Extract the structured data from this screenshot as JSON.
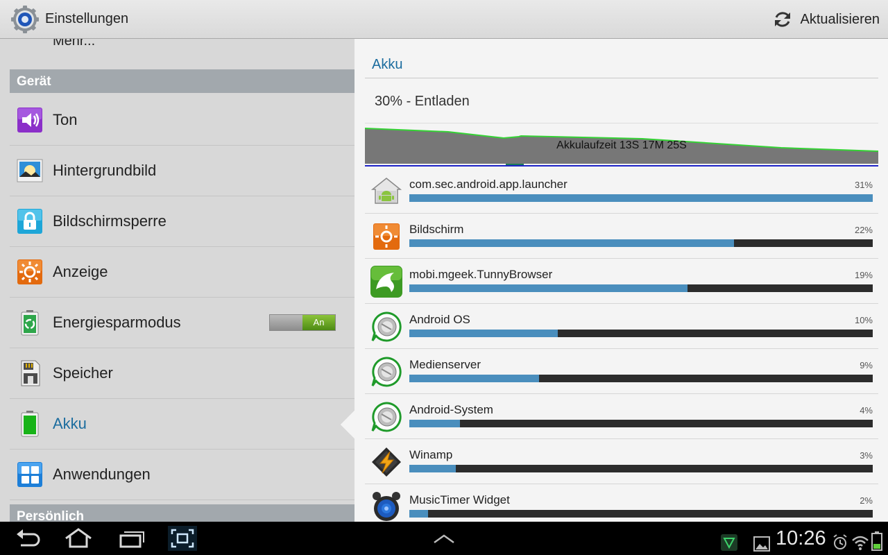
{
  "app": {
    "title": "Einstellungen",
    "refresh_label": "Aktualisieren"
  },
  "left": {
    "more_label": "Mehr...",
    "section_device": "Gerät",
    "section_personal": "Persönlich",
    "items": [
      {
        "label": "Ton",
        "icon": "sound-icon"
      },
      {
        "label": "Hintergrundbild",
        "icon": "wallpaper-icon"
      },
      {
        "label": "Bildschirmsperre",
        "icon": "lock-icon"
      },
      {
        "label": "Anzeige",
        "icon": "display-icon"
      },
      {
        "label": "Energiesparmodus",
        "icon": "power-saving-icon",
        "toggle": "An"
      },
      {
        "label": "Speicher",
        "icon": "storage-icon"
      },
      {
        "label": "Akku",
        "icon": "battery-icon",
        "selected": true
      },
      {
        "label": "Anwendungen",
        "icon": "applications-icon"
      }
    ]
  },
  "right": {
    "title": "Akku",
    "battery_status": "30% - Entladen",
    "graph_label": "Akkulaufzeit 13S 17M 25S",
    "usage": [
      {
        "name": "com.sec.android.app.launcher",
        "percent_label": "31%",
        "bar": 1.0,
        "icon": "launcher-icon"
      },
      {
        "name": "Bildschirm",
        "percent_label": "22%",
        "bar": 0.7,
        "icon": "brightness-icon"
      },
      {
        "name": "mobi.mgeek.TunnyBrowser",
        "percent_label": "19%",
        "bar": 0.6,
        "icon": "dolphin-browser-icon"
      },
      {
        "name": "Android OS",
        "percent_label": "10%",
        "bar": 0.32,
        "icon": "android-os-icon"
      },
      {
        "name": "Medienserver",
        "percent_label": "9%",
        "bar": 0.28,
        "icon": "media-server-icon"
      },
      {
        "name": "Android-System",
        "percent_label": "4%",
        "bar": 0.11,
        "icon": "android-system-icon"
      },
      {
        "name": "Winamp",
        "percent_label": "3%",
        "bar": 0.1,
        "icon": "winamp-icon"
      },
      {
        "name": "MusicTimer Widget",
        "percent_label": "2%",
        "bar": 0.04,
        "icon": "alarm-clock-icon"
      }
    ]
  },
  "status_bar": {
    "time": "10:26"
  },
  "colors": {
    "accent": "#1b6c9e",
    "usage_bar": "#4a8ebd",
    "toggle_on": "#6aa829"
  }
}
